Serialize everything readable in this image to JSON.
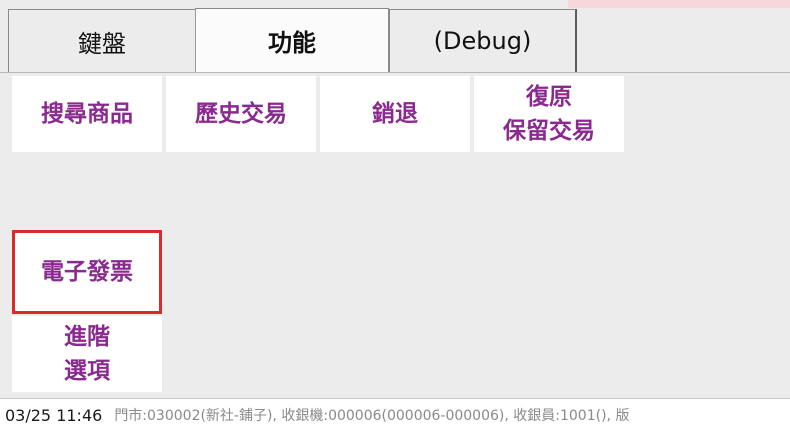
{
  "tabs": {
    "keyboard": "鍵盤",
    "function": "功能",
    "debug": "(Debug)"
  },
  "buttons": {
    "search_product": "搜尋商品",
    "history_transactions": "歷史交易",
    "void": "銷退",
    "restore_line1": "復原",
    "restore_line2": "保留交易",
    "e_invoice": "電子發票",
    "advanced_line1": "進階",
    "advanced_line2": "選項"
  },
  "status_bar": {
    "datetime": "03/25 11:46",
    "info": "門市:030002(新社-鋪子), 收銀機:000006(000006-000006), 收銀員:1001(), 版"
  },
  "colors": {
    "button_text": "#8a2a8f",
    "highlight_border": "#d92b2b",
    "background": "#ececec"
  }
}
